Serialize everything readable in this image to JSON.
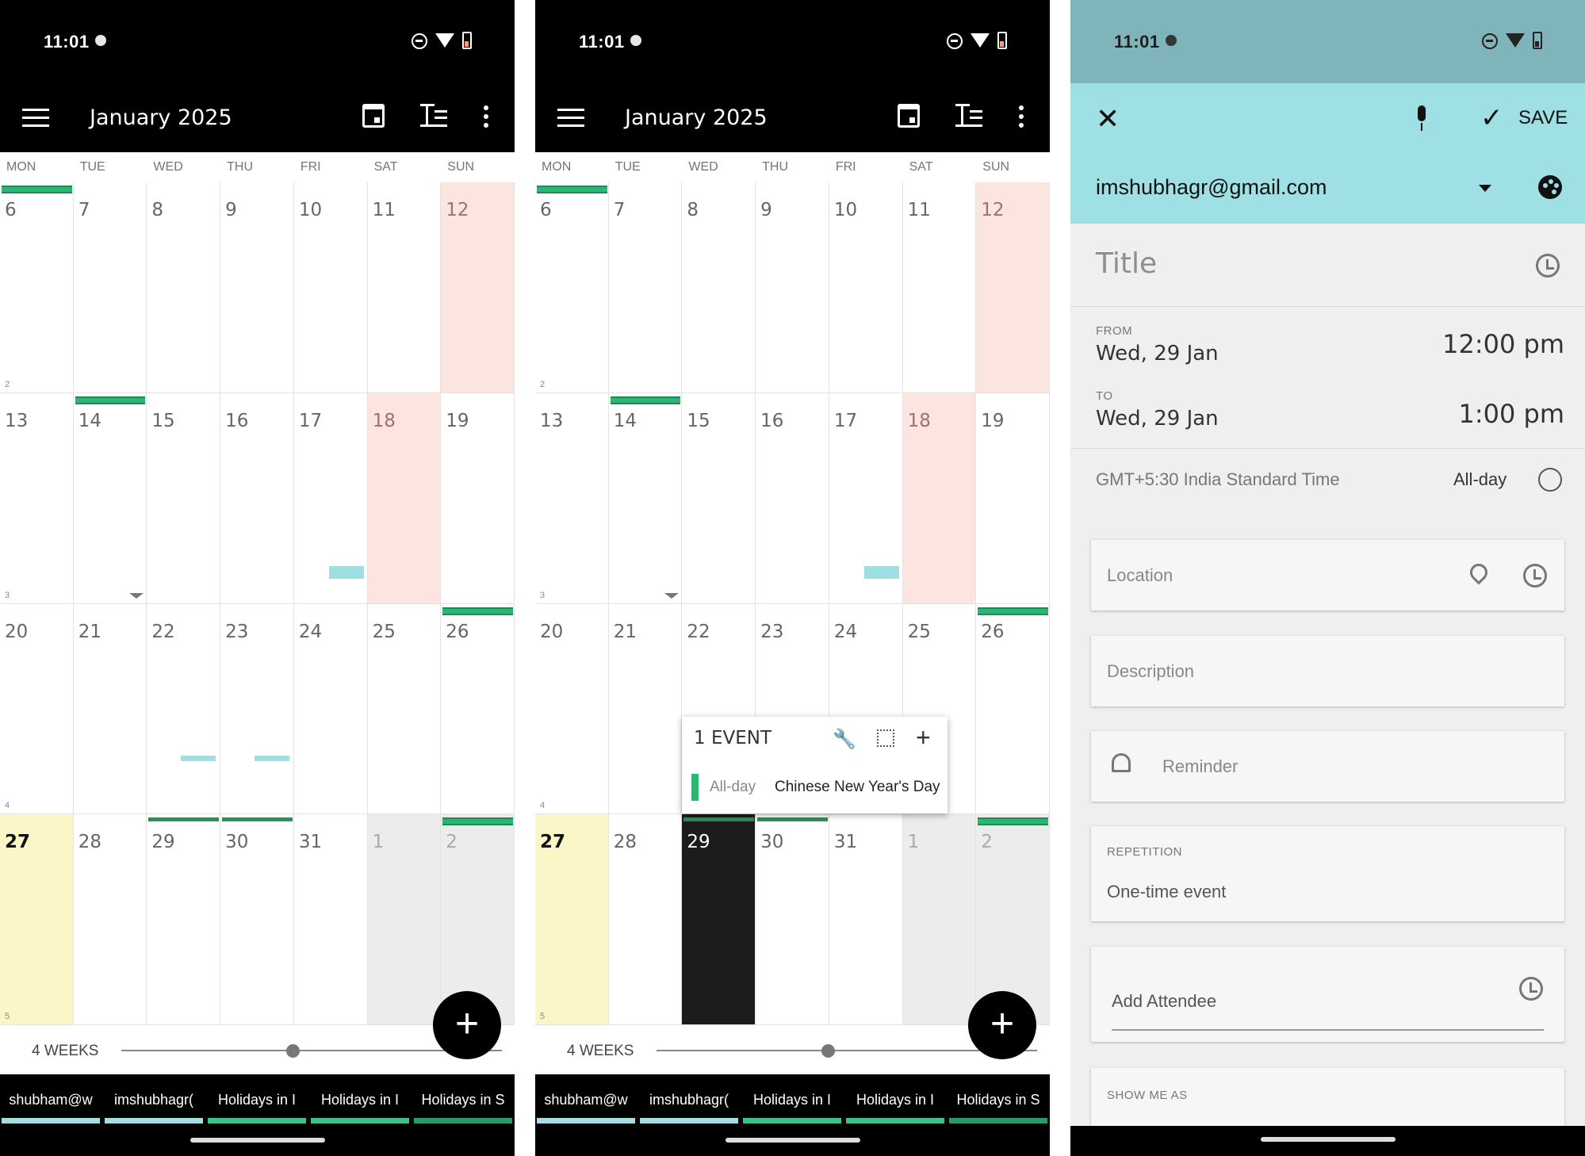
{
  "status": {
    "time": "11:01"
  },
  "calendar": {
    "month_title": "January 2025",
    "weekdays": [
      "MON",
      "TUE",
      "WED",
      "THU",
      "FRI",
      "SAT",
      "SUN"
    ],
    "weeks": [
      {
        "week_no": "2",
        "days": [
          "6",
          "7",
          "8",
          "9",
          "10",
          "11",
          "12"
        ]
      },
      {
        "week_no": "3",
        "days": [
          "13",
          "14",
          "15",
          "16",
          "17",
          "18",
          "19"
        ]
      },
      {
        "week_no": "4",
        "days": [
          "20",
          "21",
          "22",
          "23",
          "24",
          "25",
          "26"
        ]
      },
      {
        "week_no": "5",
        "days": [
          "27",
          "28",
          "29",
          "30",
          "31",
          "1",
          "2"
        ]
      }
    ],
    "weeks_label": "4 WEEKS",
    "slider_level": 0.45,
    "accounts": [
      {
        "label": "shubham@w",
        "color": "#a5dde0"
      },
      {
        "label": "imshubhagr(",
        "color": "#a5dde0"
      },
      {
        "label": "Holidays in I",
        "color": "#3ec08a"
      },
      {
        "label": "Holidays in I",
        "color": "#3ec08a"
      },
      {
        "label": "Holidays in S",
        "color": "#2a9a68"
      }
    ],
    "colors": {
      "holiday_red": "#fce4df",
      "today_yellow": "#fbf6c8",
      "grey_next": "#ececec",
      "selected": "#1c1c1c",
      "green": "#2bb673",
      "cyan": "#9ddfe2"
    }
  },
  "popup": {
    "count_label": "1 EVENT",
    "allday_label": "All-day",
    "event_name": "Chinese New Year's Day",
    "wrench_icon": "wrench-icon",
    "select_icon": "select-icon",
    "add_icon": "+"
  },
  "event_editor": {
    "close_icon": "✕",
    "save_label": "SAVE",
    "account": "imshubhagr@gmail.com",
    "title_placeholder": "Title",
    "from_label": "FROM",
    "from_date": "Wed, 29 Jan",
    "from_time": "12:00 pm",
    "to_label": "TO",
    "to_date": "Wed, 29 Jan",
    "to_time": "1:00 pm",
    "timezone": "GMT+5:30 India Standard Time",
    "allday_label": "All-day",
    "location_placeholder": "Location",
    "description_placeholder": "Description",
    "reminder_label": "Reminder",
    "repetition_label": "REPETITION",
    "repetition_value": "One-time event",
    "attendee_placeholder": "Add Attendee",
    "show_me_as_label": "SHOW ME AS"
  }
}
